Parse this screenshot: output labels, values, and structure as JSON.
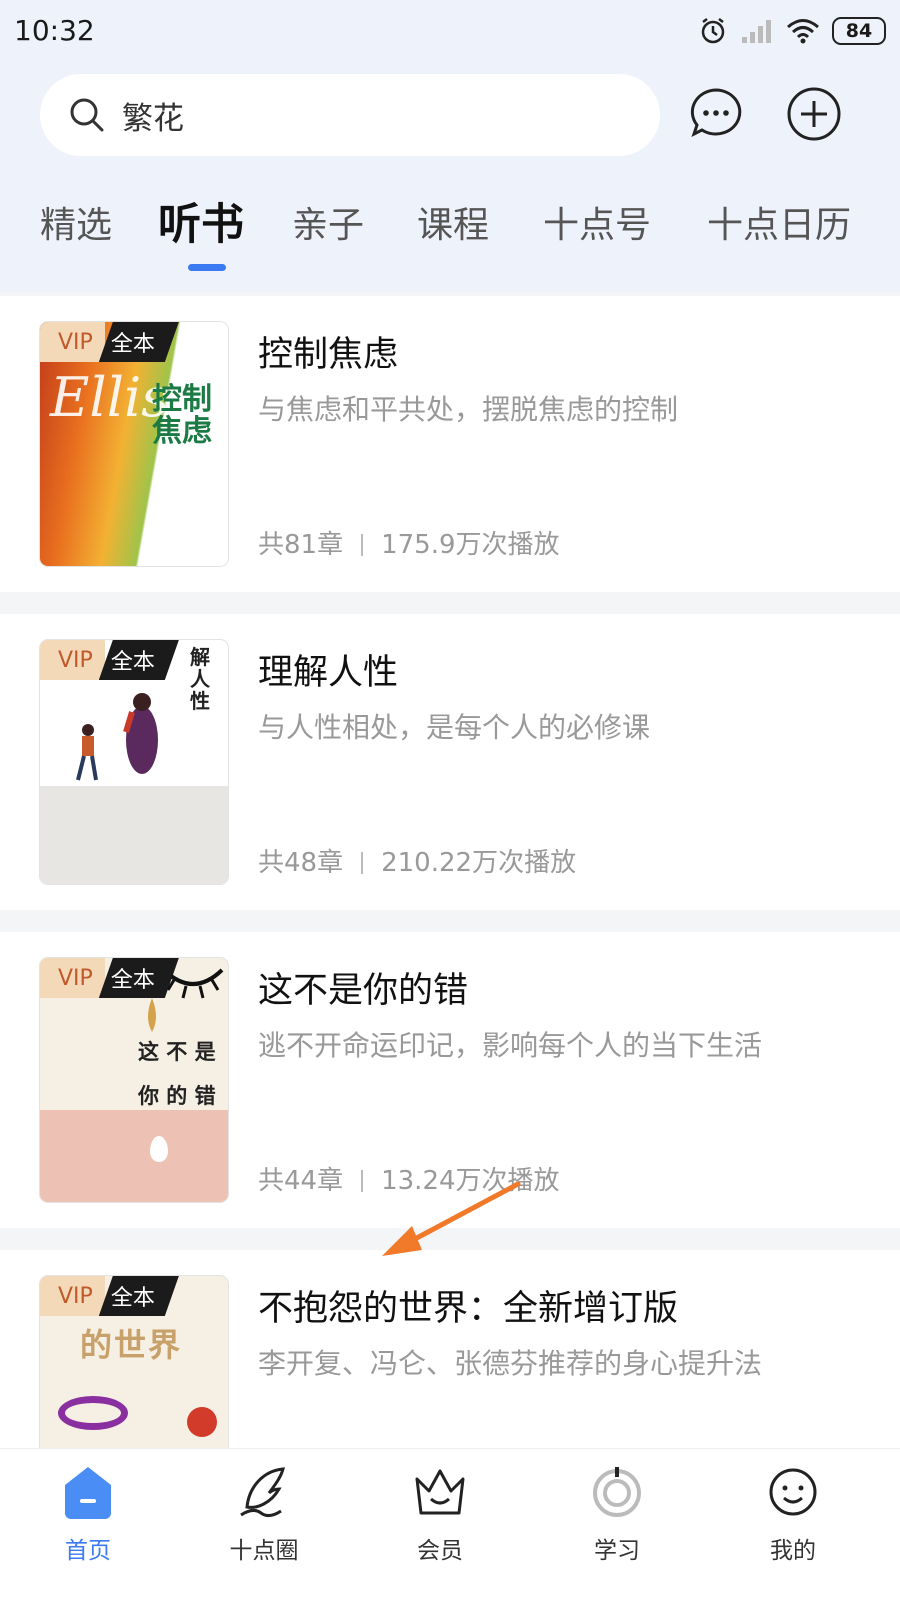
{
  "status_bar": {
    "time": "10:32",
    "battery": "84"
  },
  "search": {
    "query": "繁花"
  },
  "tabs": [
    {
      "label": "精选"
    },
    {
      "label": "听书"
    },
    {
      "label": "亲子"
    },
    {
      "label": "课程"
    },
    {
      "label": "十点号"
    },
    {
      "label": "十点日历"
    }
  ],
  "active_tab": "听书",
  "books": [
    {
      "badge_vip": "VIP",
      "badge_full": "全本",
      "title": "控制焦虑",
      "desc": "与焦虑和平共处，摆脱焦虑的控制",
      "chapters": "共81章",
      "plays": "175.9万次播放",
      "cover_title": "控制焦虑",
      "cover_text": "Ellis"
    },
    {
      "badge_vip": "VIP",
      "badge_full": "全本",
      "title": "理解人性",
      "desc": "与人性相处，是每个人的必修课",
      "chapters": "共48章",
      "plays": "210.22万次播放",
      "cover_title": "解人性"
    },
    {
      "badge_vip": "VIP",
      "badge_full": "全本",
      "title": "这不是你的错",
      "desc": "逃不开命运印记，影响每个人的当下生活",
      "chapters": "共44章",
      "plays": "13.24万次播放",
      "cover_line1": "这 不 是",
      "cover_line2": "你 的 错"
    },
    {
      "badge_vip": "VIP",
      "badge_full": "全本",
      "title": "不抱怨的世界：全新增订版",
      "desc": "李开复、冯仑、张德芬推荐的身心提升法",
      "cover_title": "的世界"
    }
  ],
  "bottom_nav": [
    {
      "label": "首页",
      "icon": "home-icon"
    },
    {
      "label": "十点圈",
      "icon": "feather-icon"
    },
    {
      "label": "会员",
      "icon": "crown-icon"
    },
    {
      "label": "学习",
      "icon": "study-icon"
    },
    {
      "label": "我的",
      "icon": "profile-icon"
    }
  ],
  "colors": {
    "accent": "#3b7af0",
    "header_bg": "#eef3fb",
    "vip_badge": "#f4d9b8",
    "arrow": "#f07a2a"
  }
}
